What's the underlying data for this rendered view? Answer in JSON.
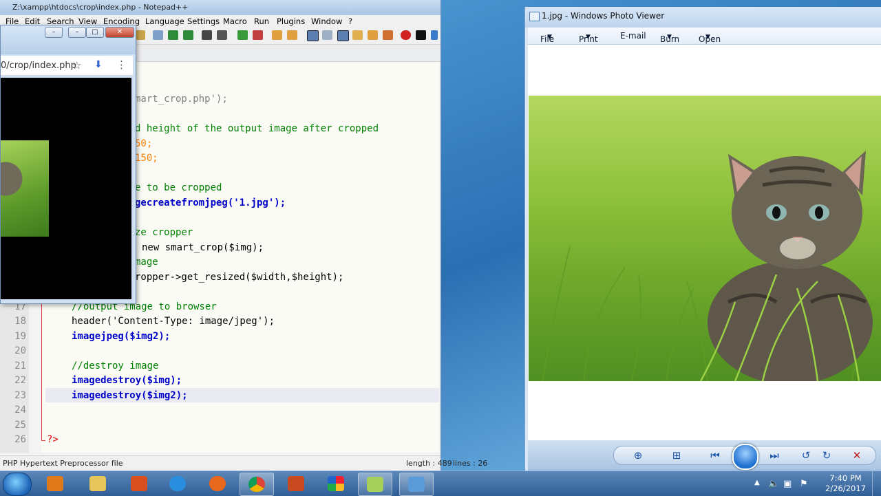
{
  "notepad": {
    "title": "Z:\\xampp\\htdocs\\crop\\index.php - Notepad++",
    "menu": [
      "File",
      "Edit",
      "Search",
      "View",
      "Encoding",
      "Language",
      "Settings",
      "Macro",
      "Run",
      "Plugins",
      "Window",
      "?"
    ],
    "lines": [
      {
        "n": "",
        "text": "mart_crop.php');"
      },
      {
        "n": "",
        "text": "d height of the output image after cropped"
      },
      {
        "n": "",
        "text": "50;"
      },
      {
        "n": "",
        "text": "150;"
      },
      {
        "n": "",
        "text": "e to be cropped"
      },
      {
        "n": "",
        "text": "gecreatefromjpeg('1.jpg');"
      },
      {
        "n": "",
        "text": "ze cropper"
      },
      {
        "n": "",
        "text": "new smart_crop($img);"
      },
      {
        "n": "",
        "text": "mage"
      },
      {
        "n": "",
        "text": "ropper->get_resized($width,$height);"
      },
      {
        "n": "17",
        "text": "//output image to browser"
      },
      {
        "n": "18",
        "text": "header('Content-Type: image/jpeg');"
      },
      {
        "n": "19",
        "text": "imagejpeg($img2);"
      },
      {
        "n": "20",
        "text": ""
      },
      {
        "n": "21",
        "text": "//destroy image"
      },
      {
        "n": "22",
        "text": "imagedestroy($img);"
      },
      {
        "n": "23",
        "text": "imagedestroy($img2);"
      },
      {
        "n": "24",
        "text": ""
      },
      {
        "n": "25",
        "text": ""
      },
      {
        "n": "26",
        "text": "?>"
      }
    ],
    "status": {
      "filetype": "PHP Hypertext Preprocessor file",
      "length": "length : 489",
      "lines": "lines : 26"
    }
  },
  "browser": {
    "url": "0/crop/index.php"
  },
  "photo_viewer": {
    "title": "1.jpg - Windows Photo Viewer",
    "menu": {
      "file": "File",
      "print": "Print",
      "email": "E-mail",
      "burn": "Burn",
      "open": "Open"
    }
  },
  "taskbar": {
    "time": "7:40 PM",
    "date": "2/26/2017"
  }
}
